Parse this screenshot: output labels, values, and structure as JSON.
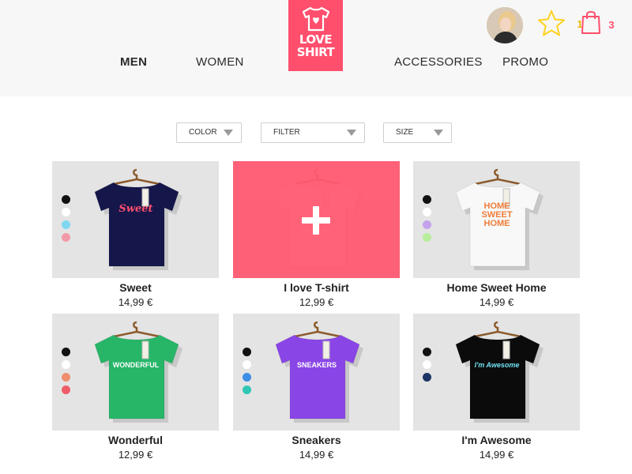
{
  "nav": {
    "men": "MEN",
    "women": "WOMEN",
    "accessories": "ACCESSORIES",
    "promo": "PROMO"
  },
  "logo": {
    "line1": "LOVE",
    "line2": "SHIRT",
    "color": "#ff4f6d"
  },
  "header_icons": {
    "favorites_count": "1",
    "cart_count": "3",
    "star_color": "#ffd21f",
    "cart_color": "#ff4f6d"
  },
  "filters": {
    "color": "COLOR",
    "filter": "FILTER",
    "size": "SIZE"
  },
  "products": [
    {
      "name": "Sweet",
      "price": "14,99 €",
      "shirt_color": "#15164a",
      "print": "Sweet",
      "print_color": "#ff4f6d",
      "swatches": [
        "#111111",
        "#ffffff",
        "#7fd7f2",
        "#f39aa8"
      ]
    },
    {
      "name": "I love T-shirt",
      "price": "12,99 €",
      "shirt_color": "#ffffff",
      "print": "",
      "print_color": "#ffffff",
      "swatches": []
    },
    {
      "name": "Home Sweet Home",
      "price": "14,99 €",
      "shirt_color": "#f8f8f8",
      "print": "HOME SWEET HOME",
      "print_color": "#ef7d3a",
      "swatches": [
        "#111111",
        "#ffffff",
        "#c4a2ec",
        "#b7ee9c"
      ]
    },
    {
      "name": "Wonderful",
      "price": "12,99 €",
      "shirt_color": "#27b568",
      "print": "WONDERFUL",
      "print_color": "#ffffff",
      "swatches": [
        "#111111",
        "#ffffff",
        "#ee8e6d",
        "#ee5c69"
      ]
    },
    {
      "name": "Sneakers",
      "price": "14,99 €",
      "shirt_color": "#8a45e6",
      "print": "SNEAKERS",
      "print_color": "#ffffff",
      "swatches": [
        "#111111",
        "#ffffff",
        "#3d8ee6",
        "#2fc7b4"
      ]
    },
    {
      "name": "I'm Awesome",
      "price": "14,99 €",
      "shirt_color": "#0b0b0b",
      "print": "I'm Awesome",
      "print_color": "#6fe0f0",
      "swatches": [
        "#111111",
        "#ffffff",
        "#1c3566"
      ]
    }
  ]
}
